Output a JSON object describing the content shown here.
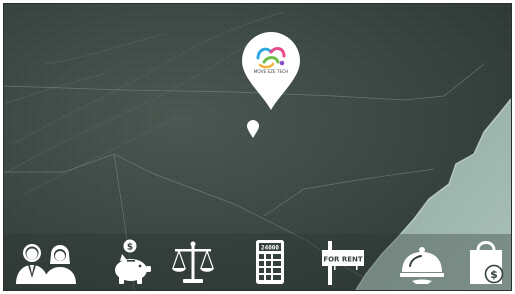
{
  "map": {
    "pin_logo_text": "MOVE EZE TECH",
    "colors": {
      "land_dark": "#34403b",
      "land_mid": "#45524c",
      "ocean": "#98b1a8",
      "coast": "#bfd0ca",
      "pin": "#ffffff",
      "icon": "#ffffff"
    }
  },
  "icons": {
    "sign_text": "FOR RENT",
    "calculator_display": "24000",
    "items": [
      {
        "name": "people-icon"
      },
      {
        "name": "piggy-bank-icon"
      },
      {
        "name": "scales-icon"
      },
      {
        "name": "calculator-icon"
      },
      {
        "name": "for-rent-sign-icon"
      },
      {
        "name": "cloche-icon"
      },
      {
        "name": "shopping-bag-icon"
      }
    ]
  }
}
